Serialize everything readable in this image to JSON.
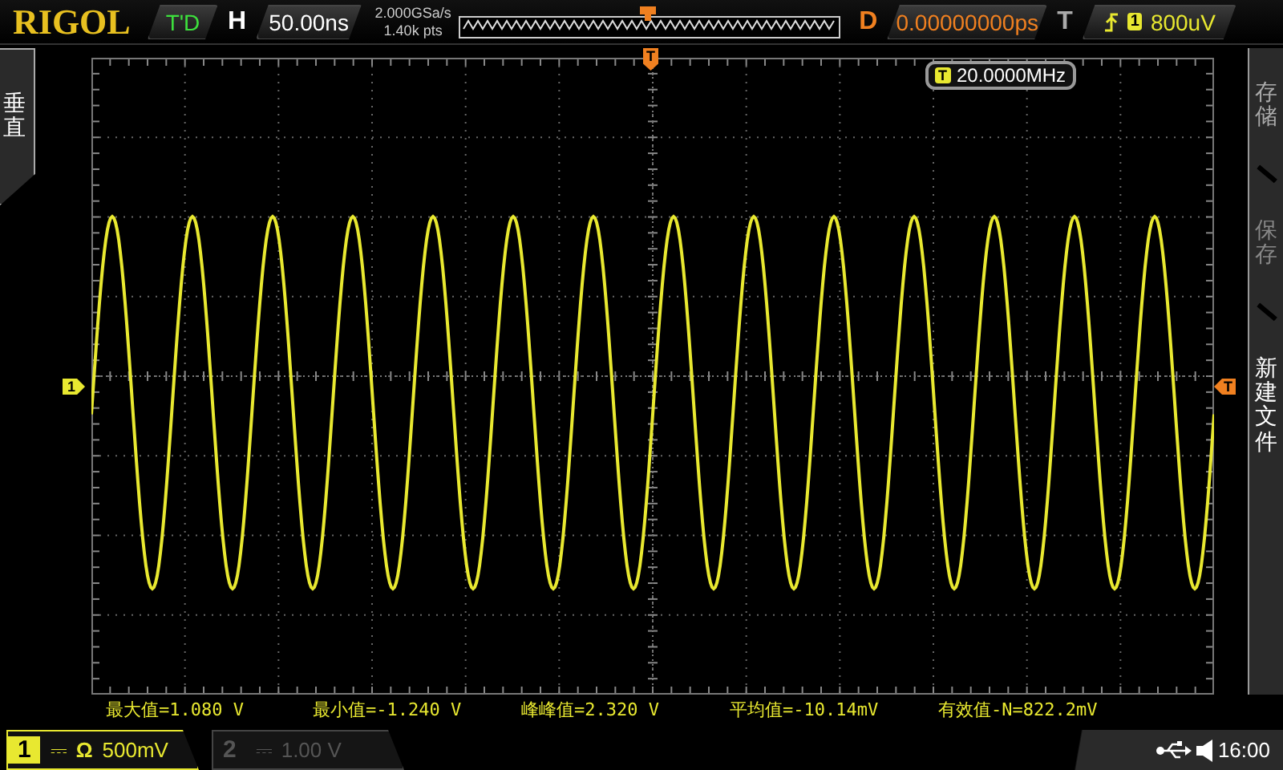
{
  "top_bar": {
    "logo": "RIGOL",
    "run_status": "T'D",
    "horizontal_label": "H",
    "timebase": "50.00ns",
    "sample_rate": "2.000GSa/s",
    "memory_depth": "1.40k pts",
    "delay_label": "D",
    "delay": "0.00000000ps",
    "trigger_label": "T",
    "trigger_source": "1",
    "trigger_level": "800uV"
  },
  "left_menu": {
    "label": "垂直"
  },
  "screen": {
    "trigger_marker": "T",
    "right_trigger_marker": "T",
    "channel_marker": "1",
    "frequency_badge": "T",
    "frequency": "20.0000MHz"
  },
  "right_menu": {
    "title": "存储",
    "items": [
      {
        "label": "保存",
        "disabled": true
      },
      {
        "label": "新建文件",
        "disabled": false
      }
    ]
  },
  "measurements": [
    "最大值=1.080 V",
    "最小值=-1.240 V",
    "峰峰值=2.320 V",
    "平均值=-10.14mV",
    "有效值-N=822.2mV"
  ],
  "channels": [
    {
      "number": "1",
      "coupling": "⎓",
      "impedance": "Ω",
      "scale": "500mV",
      "active": true
    },
    {
      "number": "2",
      "coupling": "⎓",
      "scale": "1.00 V",
      "active": false
    }
  ],
  "status_bar": {
    "time": "16:00"
  }
}
